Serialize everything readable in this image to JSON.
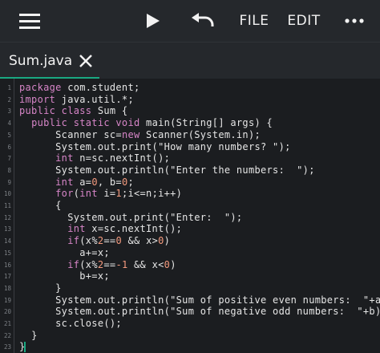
{
  "toolbar": {
    "menu_icon": "hamburger-menu-icon",
    "run_icon": "play-icon",
    "undo_icon": "undo-icon",
    "file_label": "FILE",
    "edit_label": "EDIT",
    "more_icon": "more-dots-icon"
  },
  "tab": {
    "label": "Sum.java",
    "close_icon": "close-icon",
    "accent_color": "#1aa882"
  },
  "editor": {
    "lines": [
      {
        "n": "1",
        "indent": "",
        "parts": [
          [
            "kw",
            "package"
          ],
          [
            "p",
            " com.student;"
          ]
        ]
      },
      {
        "n": "2",
        "indent": "",
        "parts": [
          [
            "kw",
            "import"
          ],
          [
            "p",
            " java.util.*;"
          ]
        ]
      },
      {
        "n": "3",
        "indent": "",
        "parts": [
          [
            "kw",
            "public class"
          ],
          [
            "p",
            " Sum {"
          ]
        ]
      },
      {
        "n": "4",
        "indent": "  ",
        "parts": [
          [
            "kw",
            "public static void"
          ],
          [
            "p",
            " main(String[] args) {"
          ]
        ]
      },
      {
        "n": "5",
        "indent": "      ",
        "parts": [
          [
            "p",
            "Scanner sc="
          ],
          [
            "kw",
            "new"
          ],
          [
            "p",
            " Scanner(System.in);"
          ]
        ]
      },
      {
        "n": "6",
        "indent": "      ",
        "parts": [
          [
            "p",
            "System.out.print(\"How many numbers? \");"
          ]
        ]
      },
      {
        "n": "7",
        "indent": "      ",
        "parts": [
          [
            "kw",
            "int"
          ],
          [
            "p",
            " n=sc.nextInt();"
          ]
        ]
      },
      {
        "n": "8",
        "indent": "      ",
        "parts": [
          [
            "p",
            "System.out.println(\"Enter the numbers:  \");"
          ]
        ]
      },
      {
        "n": "9",
        "indent": "      ",
        "parts": [
          [
            "kw",
            "int"
          ],
          [
            "p",
            " a="
          ],
          [
            "num",
            "0"
          ],
          [
            "p",
            ", b="
          ],
          [
            "num",
            "0"
          ],
          [
            "p",
            ";"
          ]
        ]
      },
      {
        "n": "10",
        "indent": "      ",
        "parts": [
          [
            "kw",
            "for"
          ],
          [
            "p",
            "("
          ],
          [
            "kw",
            "int"
          ],
          [
            "p",
            " i="
          ],
          [
            "num",
            "1"
          ],
          [
            "p",
            ";i<=n;i++)"
          ]
        ]
      },
      {
        "n": "11",
        "indent": "      ",
        "parts": [
          [
            "p",
            "{"
          ]
        ]
      },
      {
        "n": "12",
        "indent": "        ",
        "parts": [
          [
            "p",
            "System.out.print(\"Enter:  \");"
          ]
        ]
      },
      {
        "n": "13",
        "indent": "        ",
        "parts": [
          [
            "kw",
            "int"
          ],
          [
            "p",
            " x=sc.nextInt();"
          ]
        ]
      },
      {
        "n": "14",
        "indent": "        ",
        "parts": [
          [
            "kw",
            "if"
          ],
          [
            "p",
            "(x%"
          ],
          [
            "num",
            "2"
          ],
          [
            "p",
            "=="
          ],
          [
            "num",
            "0"
          ],
          [
            "p",
            " && x>"
          ],
          [
            "num",
            "0"
          ],
          [
            "p",
            ")"
          ]
        ]
      },
      {
        "n": "15",
        "indent": "          ",
        "parts": [
          [
            "p",
            "a+=x;"
          ]
        ]
      },
      {
        "n": "16",
        "indent": "        ",
        "parts": [
          [
            "kw",
            "if"
          ],
          [
            "p",
            "(x%"
          ],
          [
            "num",
            "2"
          ],
          [
            "p",
            "=="
          ],
          [
            "num",
            "-1"
          ],
          [
            "p",
            " && x<"
          ],
          [
            "num",
            "0"
          ],
          [
            "p",
            ")"
          ]
        ]
      },
      {
        "n": "17",
        "indent": "          ",
        "parts": [
          [
            "p",
            "b+=x;"
          ]
        ]
      },
      {
        "n": "18",
        "indent": "      ",
        "parts": [
          [
            "p",
            "}"
          ]
        ]
      },
      {
        "n": "19",
        "indent": "      ",
        "parts": [
          [
            "p",
            "System.out.println(\"Sum of positive even numbers:  \"+a);"
          ]
        ]
      },
      {
        "n": "20",
        "indent": "      ",
        "parts": [
          [
            "p",
            "System.out.println(\"Sum of negative odd numbers:  \"+b);"
          ]
        ]
      },
      {
        "n": "21",
        "indent": "      ",
        "parts": [
          [
            "p",
            "sc.close();"
          ]
        ]
      },
      {
        "n": "22",
        "indent": "  ",
        "parts": [
          [
            "p",
            "}"
          ]
        ]
      },
      {
        "n": "23",
        "indent": "",
        "parts": [
          [
            "p",
            "}"
          ]
        ]
      }
    ],
    "keyword_color": "#d685c7",
    "number_color": "#f39a7e"
  }
}
